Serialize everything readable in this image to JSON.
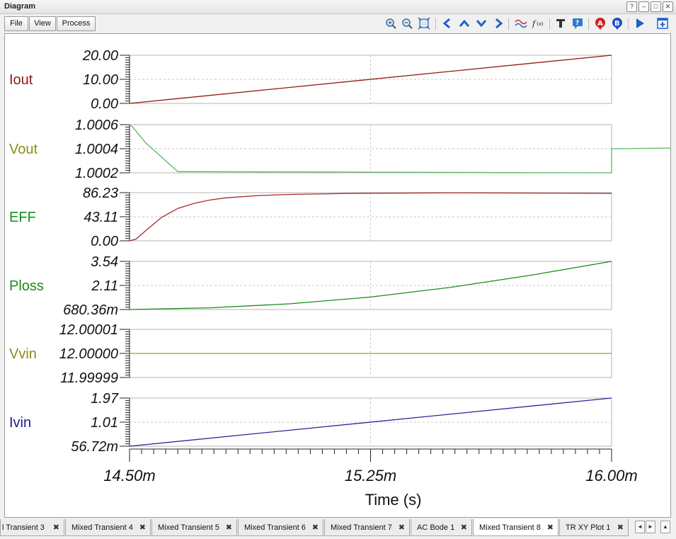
{
  "window": {
    "title": "Diagram"
  },
  "menu": {
    "file": "File",
    "view": "View",
    "process": "Process"
  },
  "window_buttons": {
    "help": "?",
    "minimize": "–",
    "maximize": "□",
    "close": "✕"
  },
  "toolbar_icons": [
    "zoom-in-icon",
    "zoom-out-icon",
    "zoom-fit-icon",
    "arrow-left-icon",
    "arrow-up-icon",
    "arrow-down-icon",
    "arrow-right-icon",
    "waveform-icon",
    "function-icon",
    "text-icon",
    "note-icon",
    "cursor-a-icon",
    "cursor-b-icon",
    "run-icon",
    "add-panel-icon"
  ],
  "tabs": [
    {
      "label": "l Transient 3"
    },
    {
      "label": "Mixed Transient 4"
    },
    {
      "label": "Mixed Transient 5"
    },
    {
      "label": "Mixed Transient 6"
    },
    {
      "label": "Mixed Transient 7"
    },
    {
      "label": "AC Bode 1"
    },
    {
      "label": "Mixed Transient 8",
      "active": true
    },
    {
      "label": "TR XY Plot 1"
    }
  ],
  "tab_close": "✖",
  "tab_nav": {
    "left": "◄",
    "right": "►",
    "up": "▲"
  },
  "chart_data": {
    "type": "line",
    "xlabel": "Time (s)",
    "x_ticks": [
      "14.50m",
      "15.25m",
      "16.00m"
    ],
    "xlim": [
      0.0145,
      0.016
    ],
    "grid": true,
    "panels": [
      {
        "name": "Iout",
        "color": "#8b1a1a",
        "ticks": [
          "20.00",
          "10.00",
          "0.00"
        ],
        "ylim": [
          0,
          20
        ],
        "x": [
          0.0145,
          0.016
        ],
        "y": [
          0,
          20
        ]
      },
      {
        "name": "Vout",
        "color": "#8b8b1a",
        "line_color": "#5cb85c",
        "ticks": [
          "1.0006",
          "1.0004",
          "1.0002"
        ],
        "ylim": [
          1.0002,
          1.0006
        ],
        "x": [
          0.0145,
          0.01451,
          0.01455,
          0.0146,
          0.01465,
          0.016,
          0.01668,
          0.0168,
          0.0171,
          0.0175,
          0.01765,
          0.01775,
          0.0178,
          0.016
        ],
        "y": [
          1.0006,
          1.00058,
          1.00045,
          1.00033,
          1.00021,
          1.0002,
          1.00042,
          1.0004,
          1.00039,
          1.0004,
          1.00041,
          1.00041,
          1.00041,
          1.0004
        ]
      },
      {
        "name": "EFF",
        "color": "#1a8b1a",
        "line_color": "#a52a2a",
        "ticks": [
          "86.23",
          "43.11",
          "0.00"
        ],
        "ylim": [
          0,
          86.23
        ],
        "x": [
          0.0145,
          0.01452,
          0.01455,
          0.0146,
          0.01465,
          0.0147,
          0.01475,
          0.0148,
          0.0149,
          0.015,
          0.0152,
          0.0155,
          0.016
        ],
        "y": [
          0,
          3,
          18,
          42,
          58,
          67,
          73,
          77,
          81,
          83,
          85,
          86,
          85
        ]
      },
      {
        "name": "Ploss",
        "color": "#1a8b1a",
        "line_color": "#1a8b1a",
        "ticks": [
          "3.54",
          "2.11",
          "680.36m"
        ],
        "ylim": [
          0.68036,
          3.54
        ],
        "x": [
          0.0145,
          0.01475,
          0.015,
          0.01525,
          0.0155,
          0.01575,
          0.016
        ],
        "y": [
          0.68036,
          0.78,
          1.02,
          1.42,
          2.0,
          2.72,
          3.54
        ]
      },
      {
        "name": "Vvin",
        "color": "#8b8b1a",
        "line_color": "#a0a030",
        "ticks": [
          "12.00001",
          "12.00000",
          "11.99999"
        ],
        "ylim": [
          11.99999,
          12.00001
        ],
        "x": [
          0.0145,
          0.016
        ],
        "y": [
          12.0,
          12.0
        ]
      },
      {
        "name": "Ivin",
        "color": "#1a1a8b",
        "line_color": "#2a2a9a",
        "ticks": [
          "1.97",
          "1.01",
          "56.72m"
        ],
        "ylim": [
          0.05672,
          1.97
        ],
        "x": [
          0.0145,
          0.016
        ],
        "y": [
          0.05672,
          1.97
        ]
      }
    ]
  }
}
